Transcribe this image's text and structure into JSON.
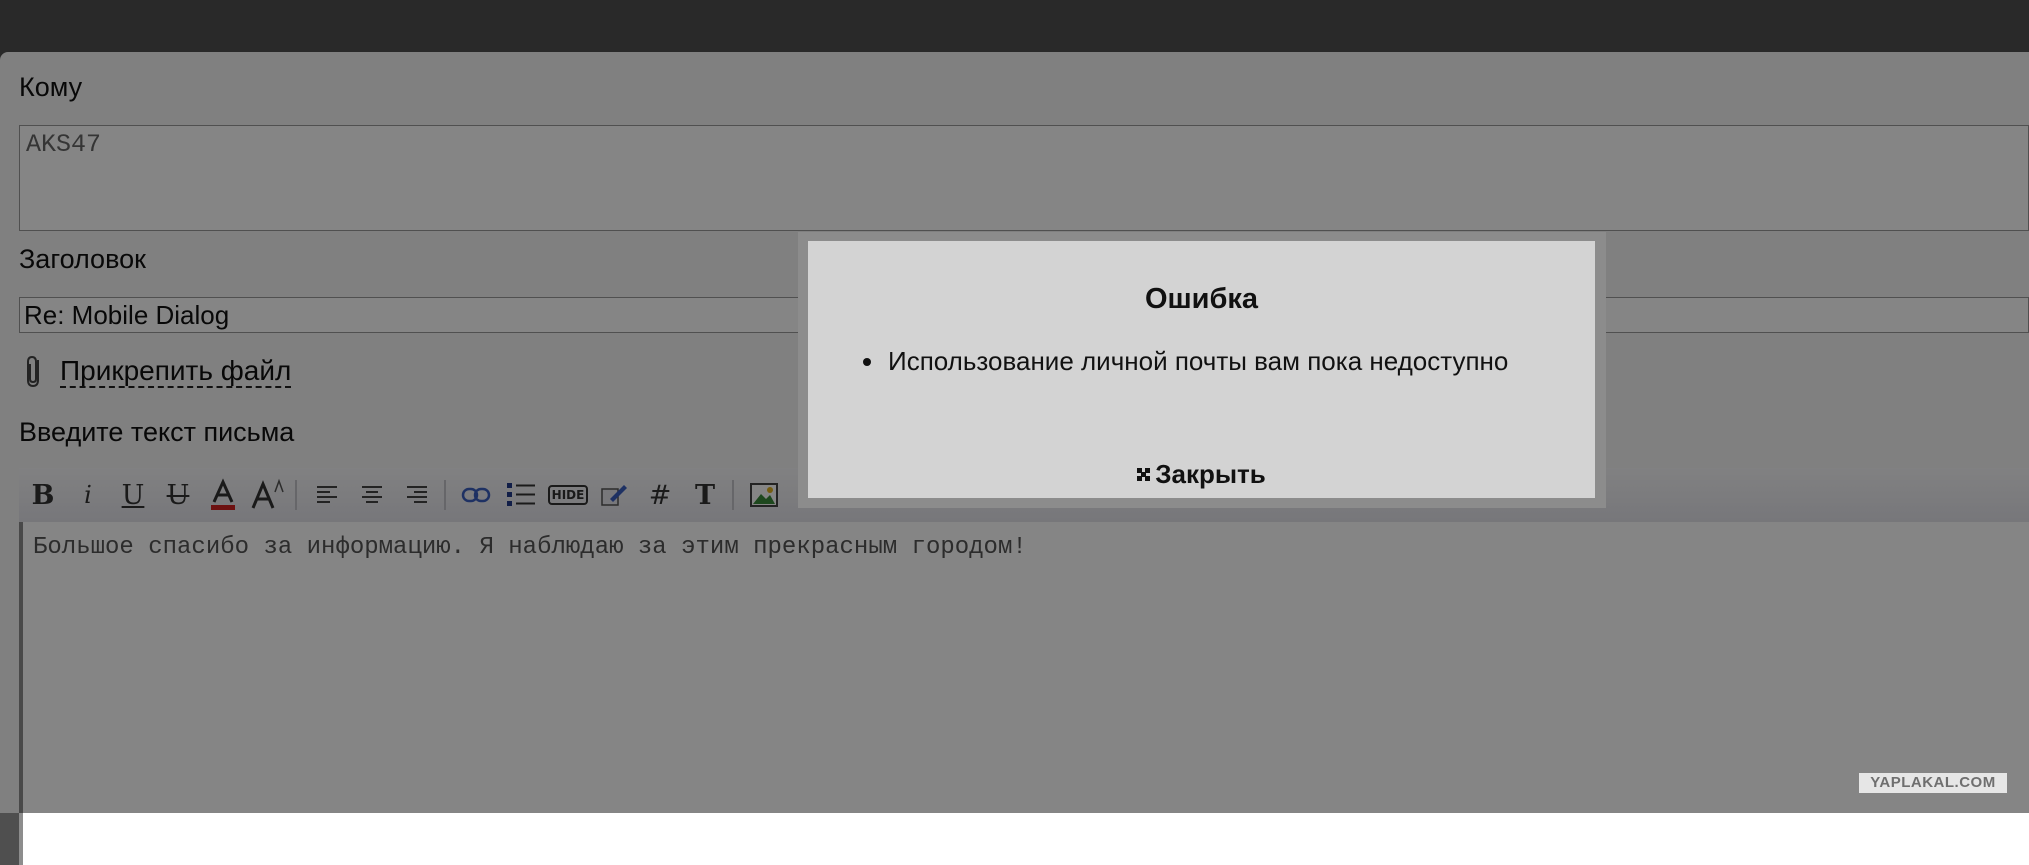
{
  "form": {
    "to_label": "Кому",
    "to_value": "AKS47",
    "subject_label": "Заголовок",
    "subject_value": "Re: Mobile Dialog",
    "attach_label": "Прикрепить файл",
    "message_label": "Введите текст письма",
    "message_text": "Большое спасибо за информацию. Я наблюдаю за этим прекрасным городом!"
  },
  "toolbar": {
    "icons": [
      "bold-icon",
      "italic-icon",
      "underline-icon",
      "strikethrough-icon",
      "font-color-icon",
      "font-size-icon",
      "align-left-icon",
      "align-center-icon",
      "align-right-icon",
      "link-icon",
      "list-icon",
      "hide-icon",
      "edit-icon",
      "hash-icon",
      "text-icon",
      "image-icon"
    ],
    "hide_label": "HIDE"
  },
  "dialog": {
    "title": "Ошибка",
    "message": "Использование личной почты вам пока недоступно",
    "close_label": "Закрыть"
  },
  "watermark": "YAPLAKAL.COM",
  "colors": {
    "overlay": "rgba(0,0,0,0.48)",
    "dialog_bg": "#d3d3d3",
    "dialog_frame": "#8c8c8c",
    "font_color_bar": "#d22222",
    "link_blue": "#3a5fbf"
  }
}
